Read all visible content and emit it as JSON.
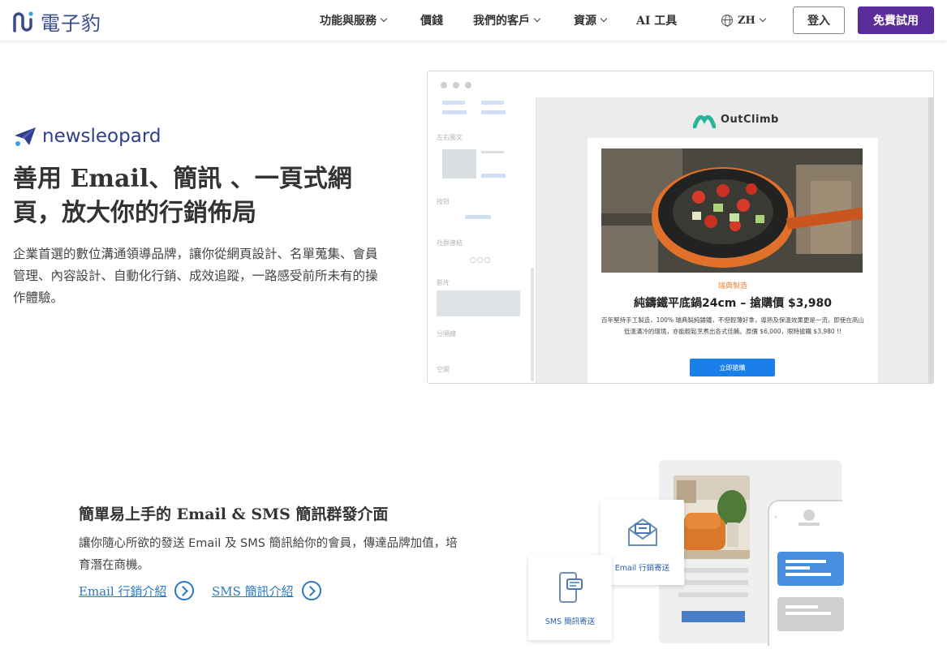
{
  "nav": {
    "logo_text": "電子豹",
    "items": [
      {
        "label": "功能與服務",
        "dropdown": true
      },
      {
        "label": "價錢",
        "dropdown": false
      },
      {
        "label": "我們的客戶",
        "dropdown": true
      },
      {
        "label": "資源",
        "dropdown": true
      },
      {
        "label": "AI 工具",
        "dropdown": false
      }
    ],
    "lang": "ZH",
    "login": "登入",
    "trial": "免費試用"
  },
  "hero": {
    "brand": "newsleopard",
    "title": "善用 Email、簡訊 、一頁式網頁，放大你的行銷佈局",
    "description": "企業首選的數位溝通領導品牌，讓你從網頁設計、名單蒐集、會員管理、內容設計、自動化行銷、成效追蹤，一路感受前所未有的操作體驗。"
  },
  "editor": {
    "sidebar_labels": [
      "左右圖文",
      "按鈕",
      "社群連結",
      "影片",
      "分隔線",
      "空間"
    ],
    "brand": "OutClimb",
    "tag": "瑞典製造",
    "product_title": "純鑄鐵平底鍋24cm – 搶購價 $3,980",
    "product_desc": "百年堅持手工製造，100% 瑞典製純鑄鐵，不但輕薄好拿，導熱及保溫效果更是一流，即使在高山低溫滿冷的環境，亦能輕鬆烹煮出各式佳餚。原價 $6,000，限時搶購 $3,980 !!",
    "cta": "立即搶購"
  },
  "section2": {
    "title": "簡單易上手的 Email & SMS 簡訊群發介面",
    "description": "讓你隨心所欲的發送 Email 及 SMS 簡訊給你的會員，傳達品牌加值，培育潛在商機。",
    "links": [
      "Email 行銷介紹",
      "SMS 簡訊介紹"
    ],
    "tiles": [
      "Email 行銷寄送",
      "SMS 簡訊寄送"
    ]
  },
  "colors": {
    "brand_purple": "#5b2d9c",
    "brand_navy": "#2f3f8c",
    "link_blue": "#2a78c4",
    "cta_blue": "#1a7fe8",
    "accent_orange": "#e8843a"
  }
}
